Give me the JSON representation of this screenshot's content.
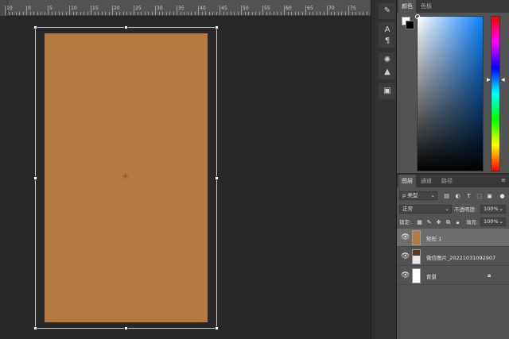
{
  "ruler": {
    "labels": [
      "10",
      "0",
      "5",
      "10",
      "15",
      "20",
      "25",
      "30",
      "35",
      "40",
      "45",
      "50",
      "55",
      "60",
      "65",
      "70",
      "75"
    ]
  },
  "canvas": {
    "artboard_color": "#b47a40",
    "transform_box": true
  },
  "toolbar": {
    "icons": [
      "brush-settings-icon",
      "character-icon",
      "paragraph-icon",
      "adjustments-icon",
      "histogram-icon",
      "libraries-icon"
    ]
  },
  "color_panel": {
    "tabs": [
      "颜色",
      "色板"
    ],
    "foreground": "#ffffff",
    "background": "#000000",
    "picker_hue": "#0a80ff"
  },
  "layers_panel": {
    "tabs": [
      "图层",
      "通道",
      "路径"
    ],
    "filter": {
      "label": "ρ 类型"
    },
    "blend_mode": "正常",
    "opacity_label": "不透明度:",
    "opacity_value": "100%",
    "lock_label": "锁定:",
    "fill_label": "填充:",
    "fill_value": "100%",
    "layers": [
      {
        "name": "矩形 1",
        "thumb_color": "#b47a40",
        "selected": true,
        "locked": false
      },
      {
        "name": "微信图片_20221031092907",
        "thumb_color": "#3a3a3a",
        "selected": false,
        "locked": false
      },
      {
        "name": "背景",
        "thumb_color": "#ffffff",
        "selected": false,
        "locked": true
      }
    ]
  }
}
